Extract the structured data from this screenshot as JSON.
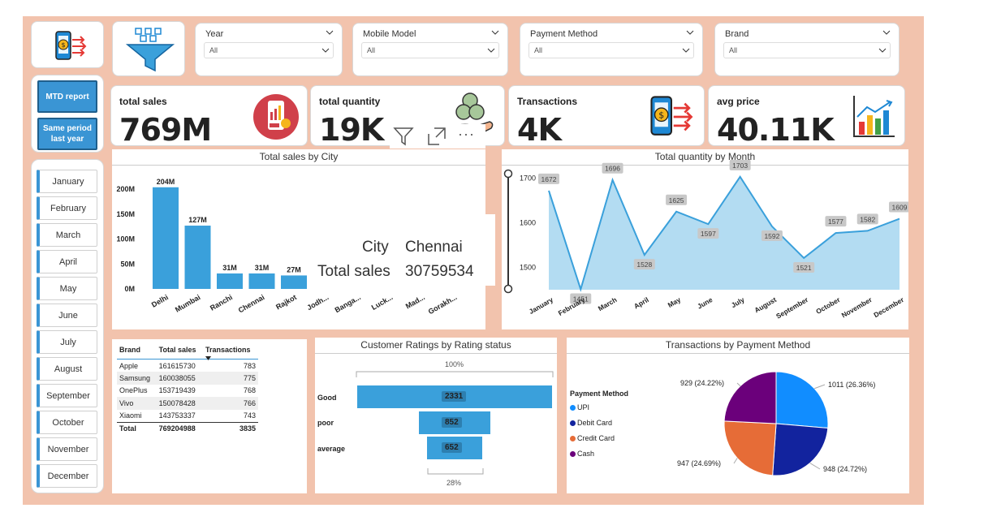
{
  "slicers": [
    {
      "title": "Year",
      "value": "All"
    },
    {
      "title": "Mobile Model",
      "value": "All"
    },
    {
      "title": "Payment Method",
      "value": "All"
    },
    {
      "title": "Brand",
      "value": "All"
    }
  ],
  "buttons": {
    "mtd": "MTD report",
    "same_period_1": "Same period",
    "same_period_2": "last year"
  },
  "months": [
    "January",
    "February",
    "March",
    "April",
    "May",
    "June",
    "July",
    "August",
    "September",
    "October",
    "November",
    "December"
  ],
  "kpis": [
    {
      "label": "total sales",
      "value": "769M",
      "icon": "sales-phone-icon"
    },
    {
      "label": "total quantity",
      "value": "19K",
      "icon": "coins-hand-icon"
    },
    {
      "label": "Transactions",
      "value": "4K",
      "icon": "mobile-payment-icon"
    },
    {
      "label": "avg price",
      "value": "40.11K",
      "icon": "bar-growth-icon"
    }
  ],
  "visual_toolbar": {
    "icons": [
      "filter-icon",
      "focus-mode-icon",
      "more-options-icon"
    ],
    "more_label": "···"
  },
  "sales_by_city": {
    "title": "Total sales by City",
    "tooltip": {
      "city_label": "City",
      "city_value": "Chennai",
      "sales_label": "Total sales",
      "sales_value": "30759534"
    }
  },
  "qty_by_month": {
    "title": "Total quantity by Month"
  },
  "brand_table": {
    "headers": [
      "Brand",
      "Total sales",
      "Transactions"
    ],
    "rows": [
      [
        "Apple",
        "161615730",
        "783"
      ],
      [
        "Samsung",
        "160038055",
        "775"
      ],
      [
        "OnePlus",
        "153719439",
        "768"
      ],
      [
        "Vivo",
        "150078428",
        "766"
      ],
      [
        "Xiaomi",
        "143753337",
        "743"
      ]
    ],
    "total": [
      "Total",
      "769204988",
      "3835"
    ]
  },
  "ratings": {
    "title": "Customer Ratings by Rating status",
    "top_pct": "100%",
    "bottom_pct": "28%",
    "labels": [
      "Good",
      "poor",
      "average"
    ],
    "values": [
      "2331",
      "852",
      "652"
    ]
  },
  "payment": {
    "title": "Transactions by Payment Method",
    "legend_title": "Payment Method",
    "legend": [
      "UPI",
      "Debit Card",
      "Credit Card",
      "Cash"
    ],
    "labels": [
      "1011 (26.36%)",
      "948 (24.72%)",
      "947 (24.69%)",
      "929 (24.22%)"
    ]
  },
  "colors": {
    "accent": "#3a95d4",
    "canvas": "#f2c3ad",
    "upi": "#118dff",
    "debit": "#12239e",
    "credit": "#e66c37",
    "cash": "#6b007b"
  },
  "chart_data": [
    {
      "type": "bar",
      "title": "Total sales by City",
      "categories": [
        "Delhi",
        "Mumbai",
        "Ranchi",
        "Chennai",
        "Rajkot",
        "Jodhpur",
        "Bangalore",
        "Lucknow",
        "Madurai",
        "Gorakhpur"
      ],
      "visible_categories": [
        "Delhi",
        "Mumbai",
        "Ranchi",
        "Chennai",
        "Rajkot",
        "Jodh...",
        "Banga...",
        "Luck...",
        "Mad...",
        "Gorakh..."
      ],
      "values": [
        204,
        127,
        31,
        31,
        27,
        null,
        null,
        null,
        null,
        null
      ],
      "value_labels": [
        "204M",
        "127M",
        "31M",
        "31M",
        "27M"
      ],
      "yticks": [
        "0M",
        "50M",
        "100M",
        "150M",
        "200M"
      ],
      "ylim": [
        0,
        215
      ]
    },
    {
      "type": "area",
      "title": "Total quantity by Month",
      "categories": [
        "January",
        "February",
        "March",
        "April",
        "May",
        "June",
        "July",
        "August",
        "September",
        "October",
        "November",
        "December"
      ],
      "values": [
        1672,
        1451,
        1696,
        1528,
        1625,
        1597,
        1703,
        1592,
        1521,
        1577,
        1582,
        1609
      ],
      "yticks": [
        1500,
        1600,
        1700
      ],
      "ylim": [
        1450,
        1710
      ]
    },
    {
      "type": "bar",
      "title": "Customer Ratings by Rating status",
      "categories": [
        "Good",
        "poor",
        "average"
      ],
      "values": [
        2331,
        852,
        652
      ]
    },
    {
      "type": "pie",
      "title": "Transactions by Payment Method",
      "categories": [
        "UPI",
        "Debit Card",
        "Credit Card",
        "Cash"
      ],
      "values": [
        1011,
        948,
        947,
        929
      ],
      "percents": [
        26.36,
        24.72,
        24.69,
        24.22
      ]
    }
  ]
}
